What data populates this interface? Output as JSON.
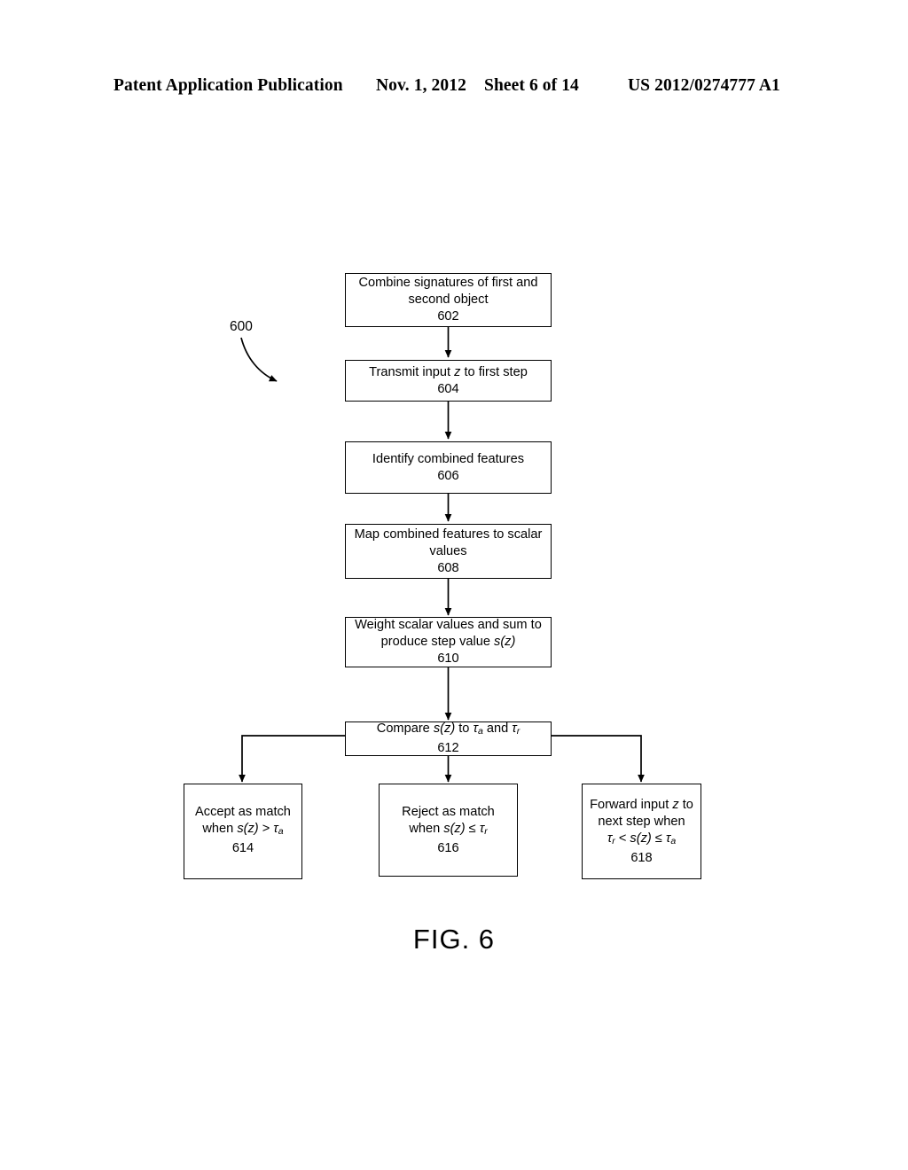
{
  "header": {
    "publication": "Patent Application Publication",
    "date": "Nov. 1, 2012",
    "sheet": "Sheet 6 of 14",
    "patent_number": "US 2012/0274777 A1"
  },
  "figure": {
    "caption": "FIG. 6",
    "reference_numeral": "600"
  },
  "flowchart": {
    "nodes": [
      {
        "id": "602",
        "lines": [
          "Combine signatures of first and",
          "second object"
        ],
        "number": "602"
      },
      {
        "id": "604",
        "lines": [
          "Transmit input z to first step"
        ],
        "number": "604"
      },
      {
        "id": "606",
        "lines": [
          "Identify combined features"
        ],
        "number": "606"
      },
      {
        "id": "608",
        "lines": [
          "Map combined features to scalar",
          "values"
        ],
        "number": "608"
      },
      {
        "id": "610",
        "lines": [
          "Weight scalar values and sum to",
          "produce step value s(z)"
        ],
        "number": "610"
      },
      {
        "id": "612",
        "lines": [
          "Compare s(z) to τa and τr"
        ],
        "number": "612"
      },
      {
        "id": "614",
        "lines": [
          "Accept as match",
          "when s(z) > τa"
        ],
        "number": "614"
      },
      {
        "id": "616",
        "lines": [
          "Reject as match",
          "when s(z) ≤ τr"
        ],
        "number": "616"
      },
      {
        "id": "618",
        "lines": [
          "Forward input z to",
          "next step when",
          "τr < s(z) ≤ τa"
        ],
        "number": "618"
      }
    ],
    "node_602_line1": "Combine signatures of first and",
    "node_602_line2": "second object",
    "node_602_num": "602",
    "node_604_pre": "Transmit input ",
    "node_604_var": "z",
    "node_604_post": " to first step",
    "node_604_num": "604",
    "node_606_line1": "Identify combined features",
    "node_606_num": "606",
    "node_608_line1": "Map combined features to scalar",
    "node_608_line2": "values",
    "node_608_num": "608",
    "node_610_line1": "Weight scalar values and sum to",
    "node_610_pre": "produce step value ",
    "node_610_var": "s(z)",
    "node_610_num": "610",
    "node_612_pre": "Compare ",
    "node_612_var": "s(z)",
    "node_612_mid": " to ",
    "node_612_tau1": "τ",
    "node_612_sub1": "a",
    "node_612_and": " and ",
    "node_612_tau2": "τ",
    "node_612_sub2": "r",
    "node_612_num": "612",
    "node_614_line1": "Accept as match",
    "node_614_pre": "when ",
    "node_614_var": "s(z)",
    "node_614_op": " > ",
    "node_614_tau": "τ",
    "node_614_sub": "a",
    "node_614_num": "614",
    "node_616_line1": "Reject as match",
    "node_616_pre": "when ",
    "node_616_var": "s(z)",
    "node_616_op": " ≤ ",
    "node_616_tau": "τ",
    "node_616_sub": "r",
    "node_616_num": "616",
    "node_618_pre": "Forward input ",
    "node_618_var": "z",
    "node_618_post": " to",
    "node_618_line2": "next step when",
    "node_618_tau1": "τ",
    "node_618_sub1": "r",
    "node_618_op1": " < ",
    "node_618_var2": "s(z)",
    "node_618_op2": " ≤ ",
    "node_618_tau2": "τ",
    "node_618_sub2": "a",
    "node_618_num": "618"
  }
}
